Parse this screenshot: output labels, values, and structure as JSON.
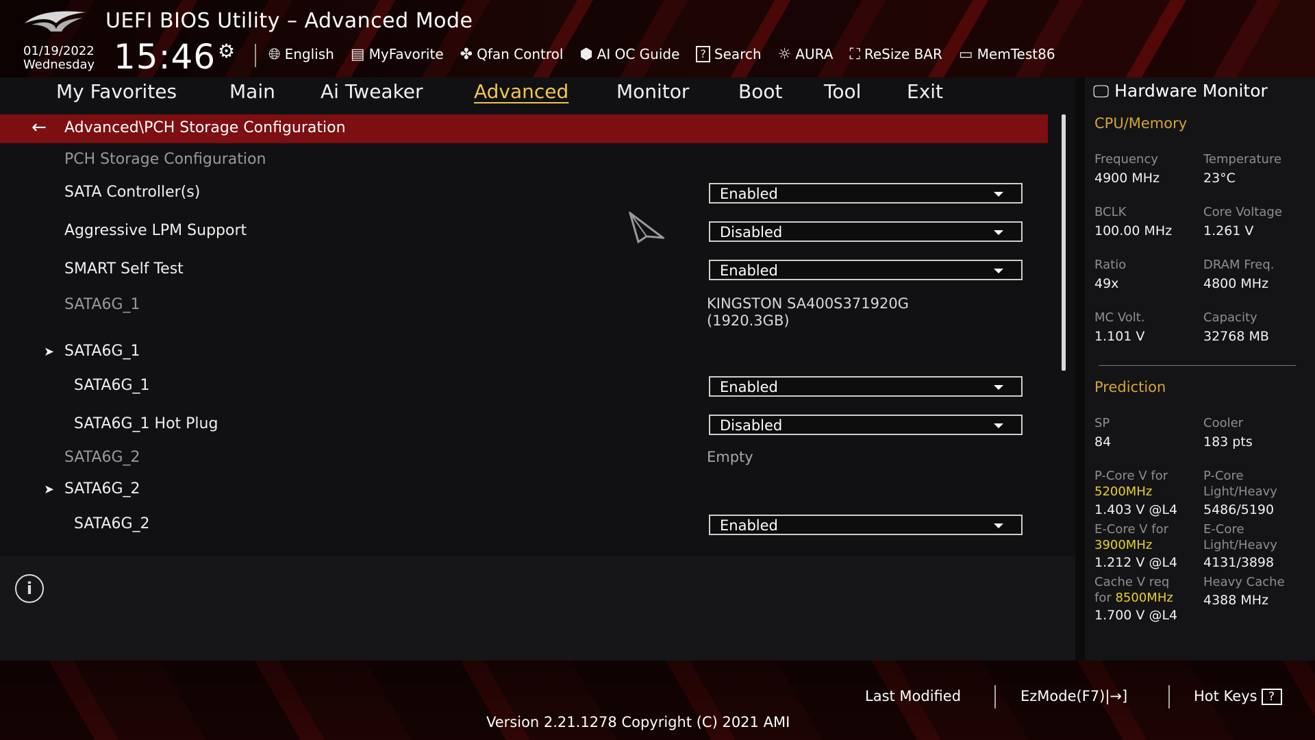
{
  "header": {
    "title": "UEFI BIOS Utility – Advanced Mode",
    "date": "01/19/2022",
    "weekday": "Wednesday",
    "time": "15:46",
    "toolbar": [
      {
        "label": "English",
        "icon": "globe-icon"
      },
      {
        "label": "MyFavorite",
        "icon": "favorite-icon"
      },
      {
        "label": "Qfan Control",
        "icon": "fan-icon"
      },
      {
        "label": "AI OC Guide",
        "icon": "ai-icon"
      },
      {
        "label": "Search",
        "icon": "search-icon"
      },
      {
        "label": "AURA",
        "icon": "aura-icon"
      },
      {
        "label": "ReSize BAR",
        "icon": "resize-bar-icon"
      },
      {
        "label": "MemTest86",
        "icon": "memtest-icon"
      }
    ]
  },
  "nav": {
    "tabs": [
      "My Favorites",
      "Main",
      "Ai Tweaker",
      "Advanced",
      "Monitor",
      "Boot",
      "Tool",
      "Exit"
    ],
    "active": "Advanced"
  },
  "main": {
    "breadcrumb": "Advanced\\PCH Storage Configuration",
    "section_title": "PCH Storage Configuration",
    "rows": {
      "sata_controllers": {
        "label": "SATA Controller(s)",
        "value": "Enabled"
      },
      "aggressive_lpm": {
        "label": "Aggressive LPM Support",
        "value": "Disabled"
      },
      "smart_self_test": {
        "label": "SMART Self Test",
        "value": "Enabled"
      },
      "sata1_info": {
        "label": "SATA6G_1",
        "value_line1": "KINGSTON SA400S371920G",
        "value_line2": "(1920.3GB)"
      },
      "sata1_sub": {
        "label": "SATA6G_1"
      },
      "sata1_enable": {
        "label": "SATA6G_1",
        "value": "Enabled"
      },
      "sata1_hotplug": {
        "label": "SATA6G_1 Hot Plug",
        "value": "Disabled"
      },
      "sata2_info": {
        "label": "SATA6G_2",
        "value": "Empty"
      },
      "sata2_sub": {
        "label": "SATA6G_2"
      },
      "sata2_enable": {
        "label": "SATA6G_2",
        "value": "Enabled"
      }
    }
  },
  "hw_monitor": {
    "title": "Hardware Monitor",
    "cpu_memory": {
      "heading": "CPU/Memory",
      "frequency": {
        "label": "Frequency",
        "value": "4900 MHz"
      },
      "temperature": {
        "label": "Temperature",
        "value": "23°C"
      },
      "bclk": {
        "label": "BCLK",
        "value": "100.00 MHz"
      },
      "core_voltage": {
        "label": "Core Voltage",
        "value": "1.261 V"
      },
      "ratio": {
        "label": "Ratio",
        "value": "49x"
      },
      "dram_freq": {
        "label": "DRAM Freq.",
        "value": "4800 MHz"
      },
      "mc_volt": {
        "label": "MC Volt.",
        "value": "1.101 V"
      },
      "capacity": {
        "label": "Capacity",
        "value": "32768 MB"
      }
    },
    "prediction": {
      "heading": "Prediction",
      "sp": {
        "label": "SP",
        "value": "84"
      },
      "cooler": {
        "label": "Cooler",
        "value": "183 pts"
      },
      "pcore_v": {
        "label": "P-Core V for",
        "freq": "5200MHz",
        "value": "1.403 V @L4"
      },
      "pcore_lh": {
        "label_line1": "P-Core",
        "label_line2": "Light/Heavy",
        "value": "5486/5190"
      },
      "ecore_v": {
        "label": "E-Core V for",
        "freq": "3900MHz",
        "value": "1.212 V @L4"
      },
      "ecore_lh": {
        "label_line1": "E-Core",
        "label_line2": "Light/Heavy",
        "value": "4131/3898"
      },
      "cache_v": {
        "label_line1": "Cache V req",
        "label_prefix": "for",
        "freq": "8500MHz",
        "value": "1.700 V @L4"
      },
      "heavy_cache": {
        "label": "Heavy Cache",
        "value": "4388 MHz"
      }
    }
  },
  "footer": {
    "last_modified": "Last Modified",
    "ezmode": "EzMode(F7)|",
    "ezmode_icon": "→]",
    "hot_keys": "Hot Keys",
    "hot_keys_icon": "?",
    "version": "Version 2.21.1278 Copyright (C) 2021 AMI"
  },
  "colors": {
    "accent_red": "#7d0f12",
    "active_tab": "#f0c64a",
    "section_heading": "#d7a530",
    "freq_highlight": "#e8d12c"
  }
}
